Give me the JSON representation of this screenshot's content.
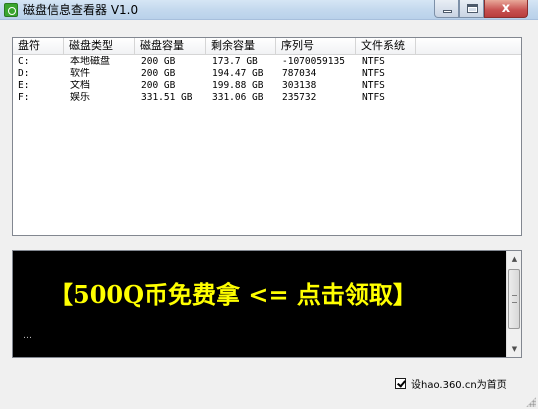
{
  "window": {
    "title": "磁盘信息查看器 V1.0",
    "close_glyph": "x"
  },
  "disk_list": {
    "columns": [
      "盘符",
      "磁盘类型",
      "磁盘容量",
      "剩余容量",
      "序列号",
      "文件系统"
    ],
    "rows": [
      {
        "drive": "C:",
        "type": "本地磁盘",
        "capacity": "200 GB",
        "free": "173.7 GB",
        "serial": "-1070059135",
        "fs": "NTFS"
      },
      {
        "drive": "D:",
        "type": "软件",
        "capacity": "200 GB",
        "free": "194.47 GB",
        "serial": "787034",
        "fs": "NTFS"
      },
      {
        "drive": "E:",
        "type": "文档",
        "capacity": "200 GB",
        "free": "199.88 GB",
        "serial": "303138",
        "fs": "NTFS"
      },
      {
        "drive": "F:",
        "type": "娱乐",
        "capacity": "331.51 GB",
        "free": "331.06 GB",
        "serial": "235732",
        "fs": "NTFS"
      }
    ]
  },
  "ad": {
    "text": "【500Q币免费拿 <= 点击领取】",
    "dots": "…",
    "scroll_up": "▲",
    "scroll_down": "▼"
  },
  "homepage_option": {
    "checked": true,
    "label": "设hao.360.cn为首页"
  },
  "colors": {
    "ad_text": "#ffff00",
    "ad_background": "#000000"
  }
}
